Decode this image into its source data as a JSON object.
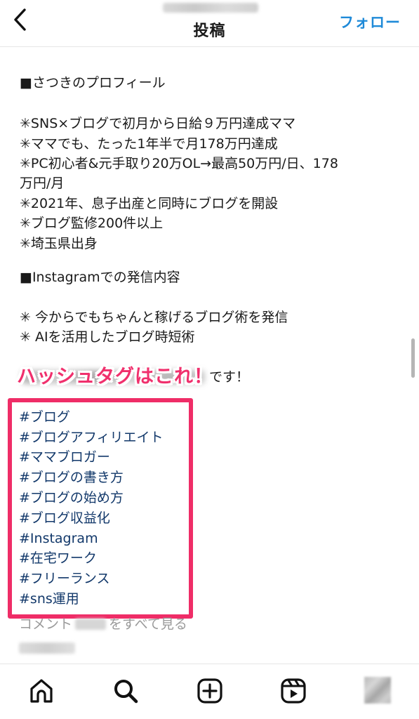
{
  "header": {
    "title": "投稿",
    "follow_label": "フォロー"
  },
  "caption": {
    "lines": [
      "■さつきのプロフィール",
      "✳SNS×ブログで初月から日給９万円達成ママ",
      "✳ママでも、たった1年半で月178万円達成",
      "✳PC初心者&元手取り20万OL→最高50万円/日、178",
      "万円/月",
      "✳2021年、息子出産と同時にブログを開設",
      "✳ブログ監修200件以上",
      "✳埼玉県出身",
      "■Instagramでの発信内容",
      "✳ 今からでもちゃんと稼げるブログ術を発信",
      "✳ AIを活用したブログ時短術"
    ],
    "line_tail": "です！"
  },
  "annotation": "ハッシュタグはこれ！",
  "hashtags": [
    "#ブログ",
    "#ブログアフィリエイト",
    "#ママブロガー",
    "#ブログの書き方",
    "#ブログの始め方",
    "#ブログ収益化",
    "#Instagram",
    "#在宅ワーク",
    "#フリーランス",
    "#sns運用"
  ],
  "comments": {
    "prefix": "コメント",
    "suffix": "をすべて見る"
  },
  "tabbar": {
    "icons": [
      "home-icon",
      "search-icon",
      "create-icon",
      "reels-icon",
      "profile-avatar"
    ]
  },
  "colors": {
    "accent": "#1f8ad8",
    "hashtag": "#12386a",
    "highlight": "#ef2d67",
    "muted": "#9a9a9a"
  }
}
